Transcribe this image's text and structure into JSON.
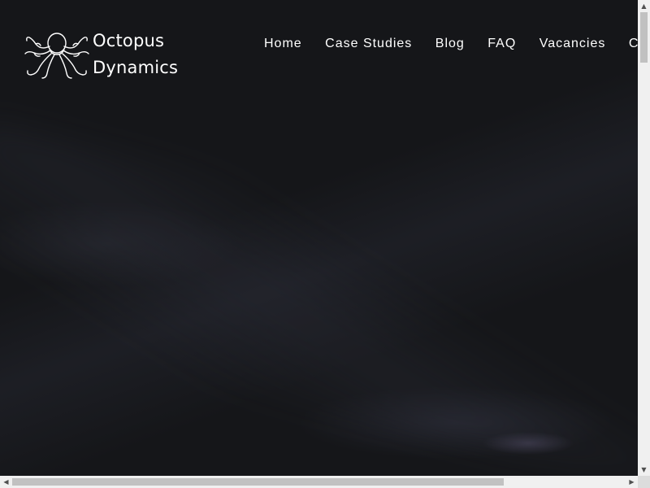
{
  "brand": {
    "logo_icon": "octopus-outline-icon",
    "name_line1": "Octopus",
    "name_line2": "Dynamics"
  },
  "nav": {
    "items": [
      {
        "label": "Home"
      },
      {
        "label": "Case Studies"
      },
      {
        "label": "Blog"
      },
      {
        "label": "FAQ"
      },
      {
        "label": "Vacancies"
      },
      {
        "label": "Contact"
      }
    ]
  },
  "scrollbars": {
    "vertical": {
      "up_icon": "arrow-up-icon",
      "down_icon": "arrow-down-icon",
      "up_glyph": "▲",
      "down_glyph": "▼",
      "position": 0
    },
    "horizontal": {
      "left_icon": "arrow-left-icon",
      "right_icon": "arrow-right-icon",
      "left_glyph": "◀",
      "right_glyph": "▶",
      "position": 0
    }
  },
  "colors": {
    "background": "#16171b",
    "text": "#ffffff",
    "scrollbar_track": "#f0f0f0",
    "scrollbar_thumb": "#c1c1c1"
  }
}
